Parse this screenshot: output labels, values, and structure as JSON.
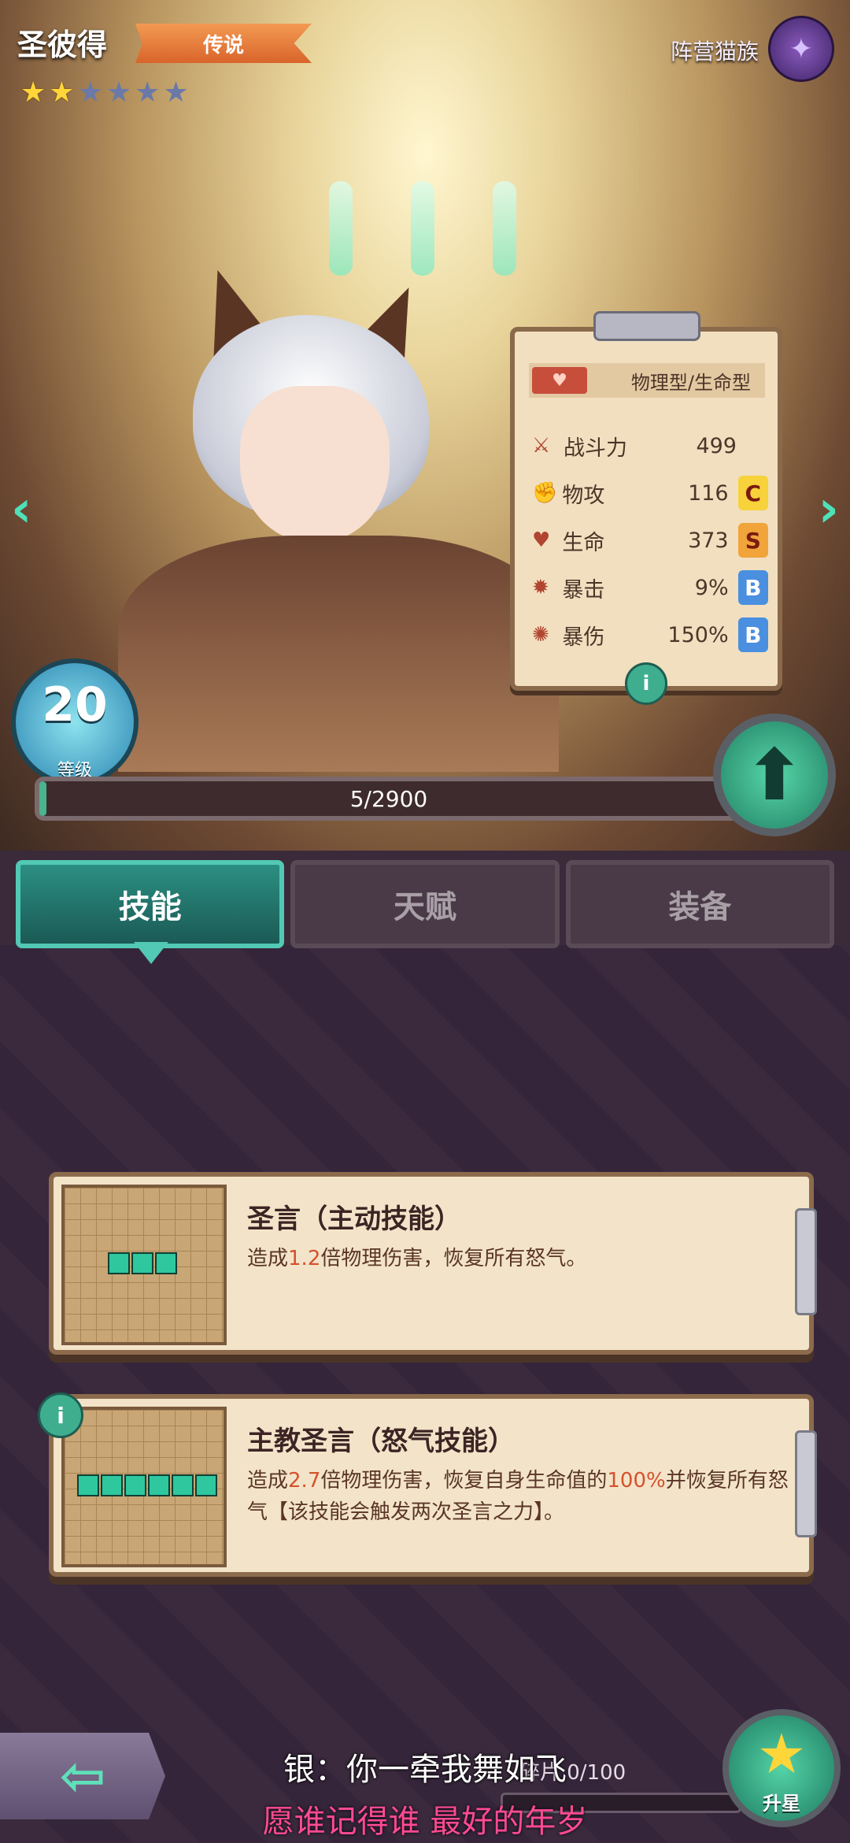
{
  "hero": {
    "name": "圣彼得",
    "rarity": "传说",
    "stars_filled": 2,
    "stars_total": 6,
    "faction_label": "阵营猫族",
    "faction_icon": "fish-bone-icon",
    "level": "20",
    "level_label": "等级",
    "xp_text": "5/2900",
    "xp_fraction": 0.0017
  },
  "stats": {
    "type": "物理型/生命型",
    "rows": [
      {
        "icon": "swords-icon",
        "label": "战斗力",
        "value": "499",
        "grade": ""
      },
      {
        "icon": "fist-icon",
        "label": "物攻",
        "value": "116",
        "grade": "C"
      },
      {
        "icon": "heart-icon",
        "label": "生命",
        "value": "373",
        "grade": "S"
      },
      {
        "icon": "crit-icon",
        "label": "暴击",
        "value": "9%",
        "grade": "B"
      },
      {
        "icon": "burst-icon",
        "label": "暴伤",
        "value": "150%",
        "grade": "B"
      }
    ],
    "info": "i"
  },
  "tabs": [
    "技能",
    "天赋",
    "装备"
  ],
  "skills": [
    {
      "name": "圣言（主动技能）",
      "desc_pre": "造成",
      "desc_hl": "1.2",
      "desc_post": "倍物理伤害，恢复所有怒气。",
      "cells": 3
    },
    {
      "name": "主教圣言（怒气技能）",
      "desc_pre": "造成",
      "desc_hl": "2.7",
      "desc_mid": "倍物理伤害，恢复自身生命值的",
      "desc_hl2": "100%",
      "desc_post": "并恢复所有怒气【该技能会触发两次圣言之力】。",
      "cells": 6
    }
  ],
  "bottom": {
    "shards_text": "碎片 0/100",
    "star_up_label": "升星",
    "lyric_line1": "银：你一牵我舞如飞",
    "lyric_line2": "愿谁记得谁 最好的年岁"
  },
  "colors": {
    "accent": "#49b48e",
    "grade_C": "#f7d23a",
    "grade_S": "#f0a43a",
    "grade_B": "#4a8fe0"
  }
}
